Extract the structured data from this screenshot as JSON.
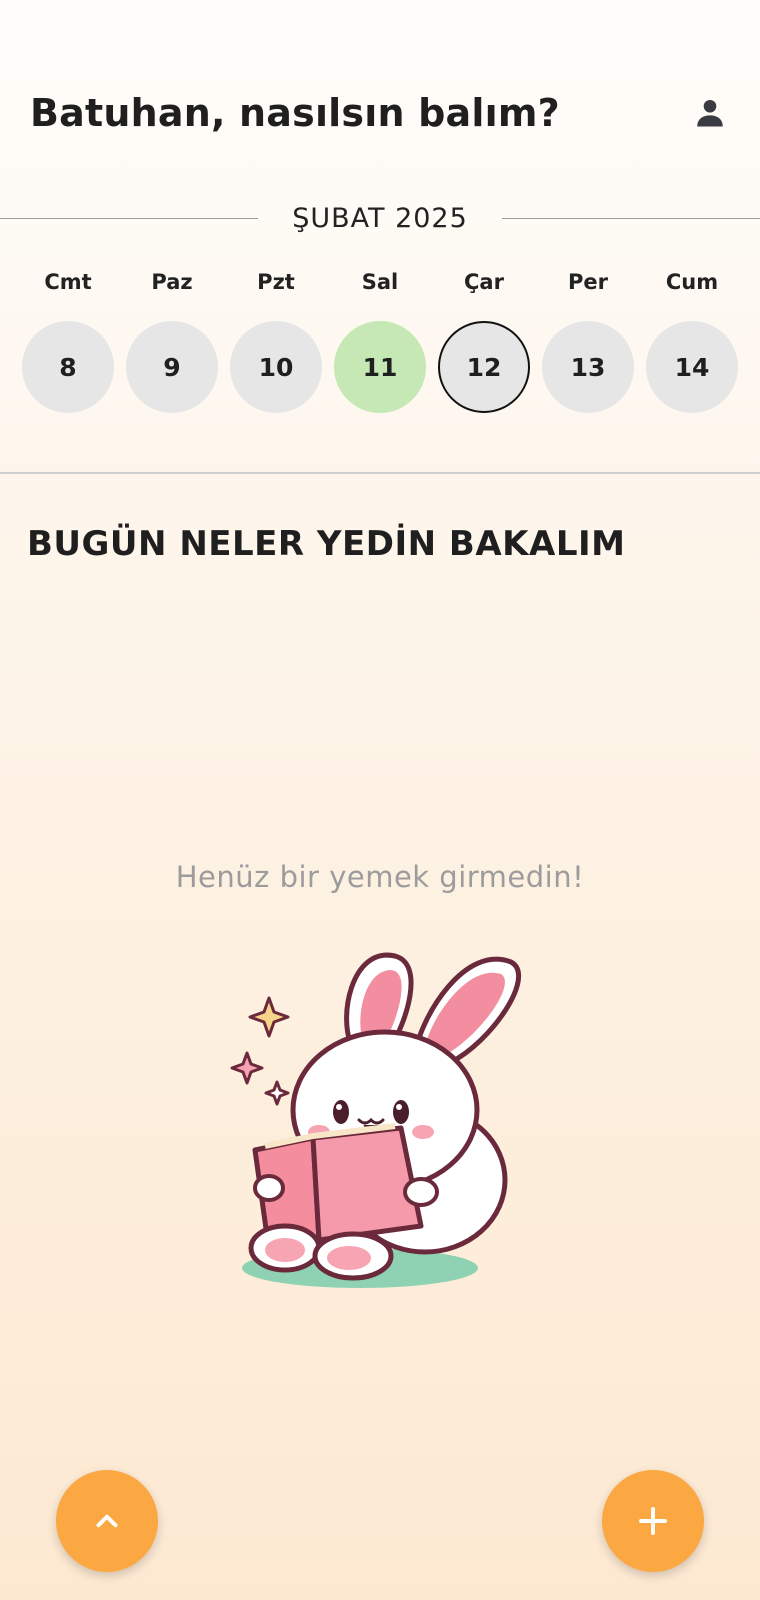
{
  "header": {
    "greeting": "Batuhan, nasılsın balım?",
    "profile_icon": "person-icon"
  },
  "calendar": {
    "month": "ŞUBAT 2025",
    "weekdays": [
      "Cmt",
      "Paz",
      "Pzt",
      "Sal",
      "Çar",
      "Per",
      "Cum"
    ],
    "days": [
      "8",
      "9",
      "10",
      "11",
      "12",
      "13",
      "14"
    ],
    "today_index": 3,
    "selected_index": 4,
    "colors": {
      "today": "#c5e8b4",
      "day": "#e6e6e6",
      "selected_border": "#111111"
    }
  },
  "main": {
    "section_title": "BUGÜN NELER YEDİN BAKALIM",
    "empty_message": "Henüz bir yemek girmedin!",
    "illustration": "bunny-reading-book"
  },
  "actions": {
    "scroll_up_icon": "chevron-up-icon",
    "add_icon": "plus-icon",
    "fab_color": "#fba843"
  }
}
